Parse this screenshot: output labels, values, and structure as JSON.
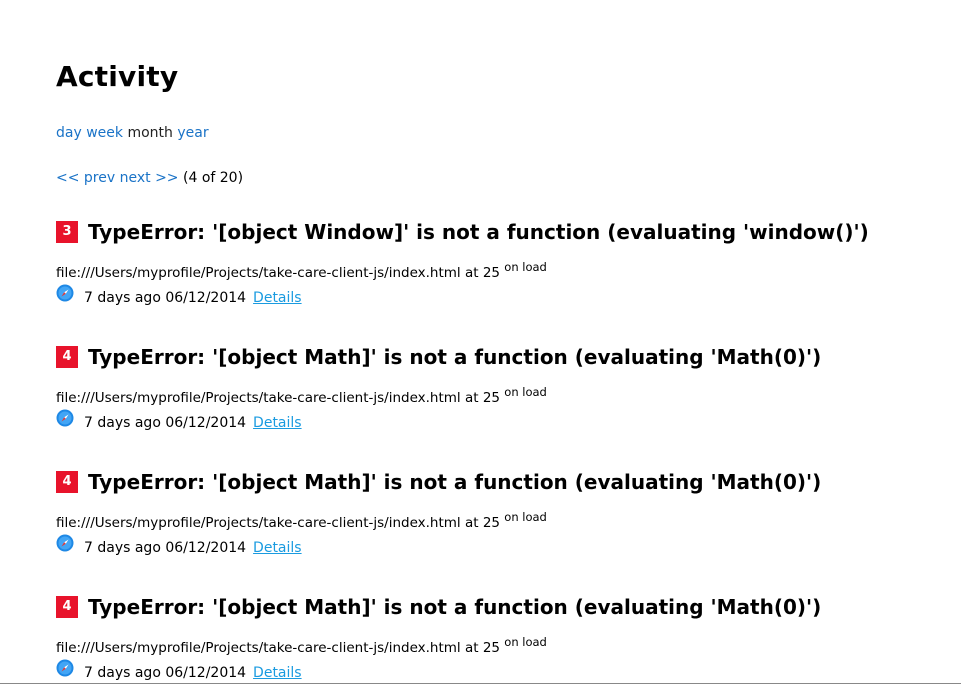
{
  "title": "Activity",
  "period_nav": {
    "day": "day",
    "week": "week",
    "month": "month",
    "year": "year"
  },
  "pager": {
    "prev": "<< prev",
    "next": "next >>",
    "position": "(4 of 20)"
  },
  "errors": [
    {
      "count": "3",
      "title": "TypeError: '[object Window]' is not a function (evaluating 'window()')",
      "source": "file:///Users/myprofile/Projects/take-care-client-js/index.html at 25",
      "context": "on load",
      "browser_icon": "safari-icon",
      "age": "7 days ago",
      "date": "06/12/2014",
      "details": "Details"
    },
    {
      "count": "4",
      "title": "TypeError: '[object Math]' is not a function (evaluating 'Math(0)')",
      "source": "file:///Users/myprofile/Projects/take-care-client-js/index.html at 25",
      "context": "on load",
      "browser_icon": "safari-icon",
      "age": "7 days ago",
      "date": "06/12/2014",
      "details": "Details"
    },
    {
      "count": "4",
      "title": "TypeError: '[object Math]' is not a function (evaluating 'Math(0)')",
      "source": "file:///Users/myprofile/Projects/take-care-client-js/index.html at 25",
      "context": "on load",
      "browser_icon": "safari-icon",
      "age": "7 days ago",
      "date": "06/12/2014",
      "details": "Details"
    },
    {
      "count": "4",
      "title": "TypeError: '[object Math]' is not a function (evaluating 'Math(0)')",
      "source": "file:///Users/myprofile/Projects/take-care-client-js/index.html at 25",
      "context": "on load",
      "browser_icon": "safari-icon",
      "age": "7 days ago",
      "date": "06/12/2014",
      "details": "Details"
    }
  ],
  "colors": {
    "link": "#1a73c7",
    "details_link": "#1a9be0",
    "badge": "#e8132b"
  }
}
